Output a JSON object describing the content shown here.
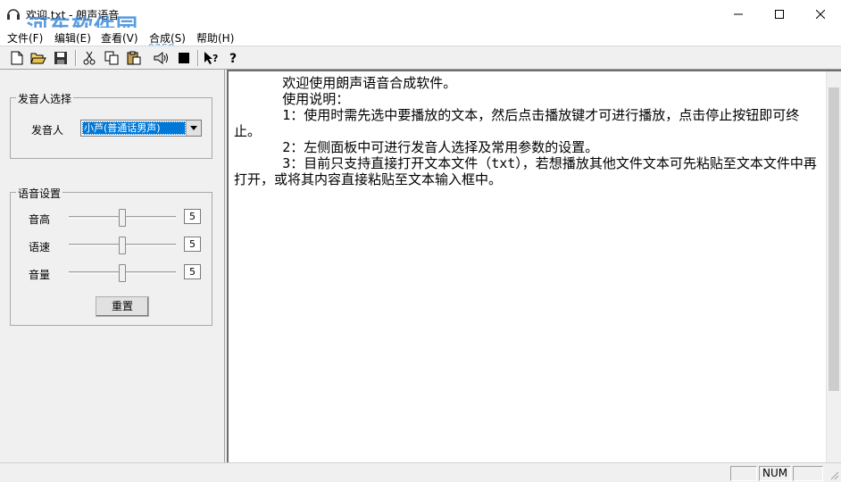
{
  "window": {
    "title": "欢迎.txt - 朗声语音",
    "watermark": "河东软件园",
    "watermark_url": "www.pc0359.cn"
  },
  "menu": [
    "文件(F)",
    "编辑(E)",
    "查看(V)",
    "合成(S)",
    "帮助(H)"
  ],
  "toolbar": {
    "icons": [
      "new-file-icon",
      "open-folder-icon",
      "save-icon",
      "cut-icon",
      "copy-icon",
      "paste-icon",
      "speaker-icon",
      "stop-icon",
      "context-help-icon",
      "help-icon"
    ]
  },
  "speaker_group": {
    "title": "发音人选择",
    "label": "发音人",
    "selected": "小芦(普通话男声)"
  },
  "voice_group": {
    "title": "语音设置",
    "pitch": {
      "label": "音高",
      "value": "5",
      "level": 0.5
    },
    "speed": {
      "label": "语速",
      "value": "5",
      "level": 0.5
    },
    "volume": {
      "label": "音量",
      "value": "5",
      "level": 0.5
    },
    "reset": "重置"
  },
  "editor": {
    "text": "      欢迎使用朗声语音合成软件。\n      使用说明：\n      1：使用时需先选中要播放的文本，然后点击播放键才可进行播放，点击停止按钮即可终止。\n      2：左侧面板中可进行发音人选择及常用参数的设置。\n      3：目前只支持直接打开文本文件（txt），若想播放其他文件文本可先粘贴至文本文件中再打开，或将其内容直接粘贴至文本输入框中。"
  },
  "status": {
    "num": "NUM"
  }
}
